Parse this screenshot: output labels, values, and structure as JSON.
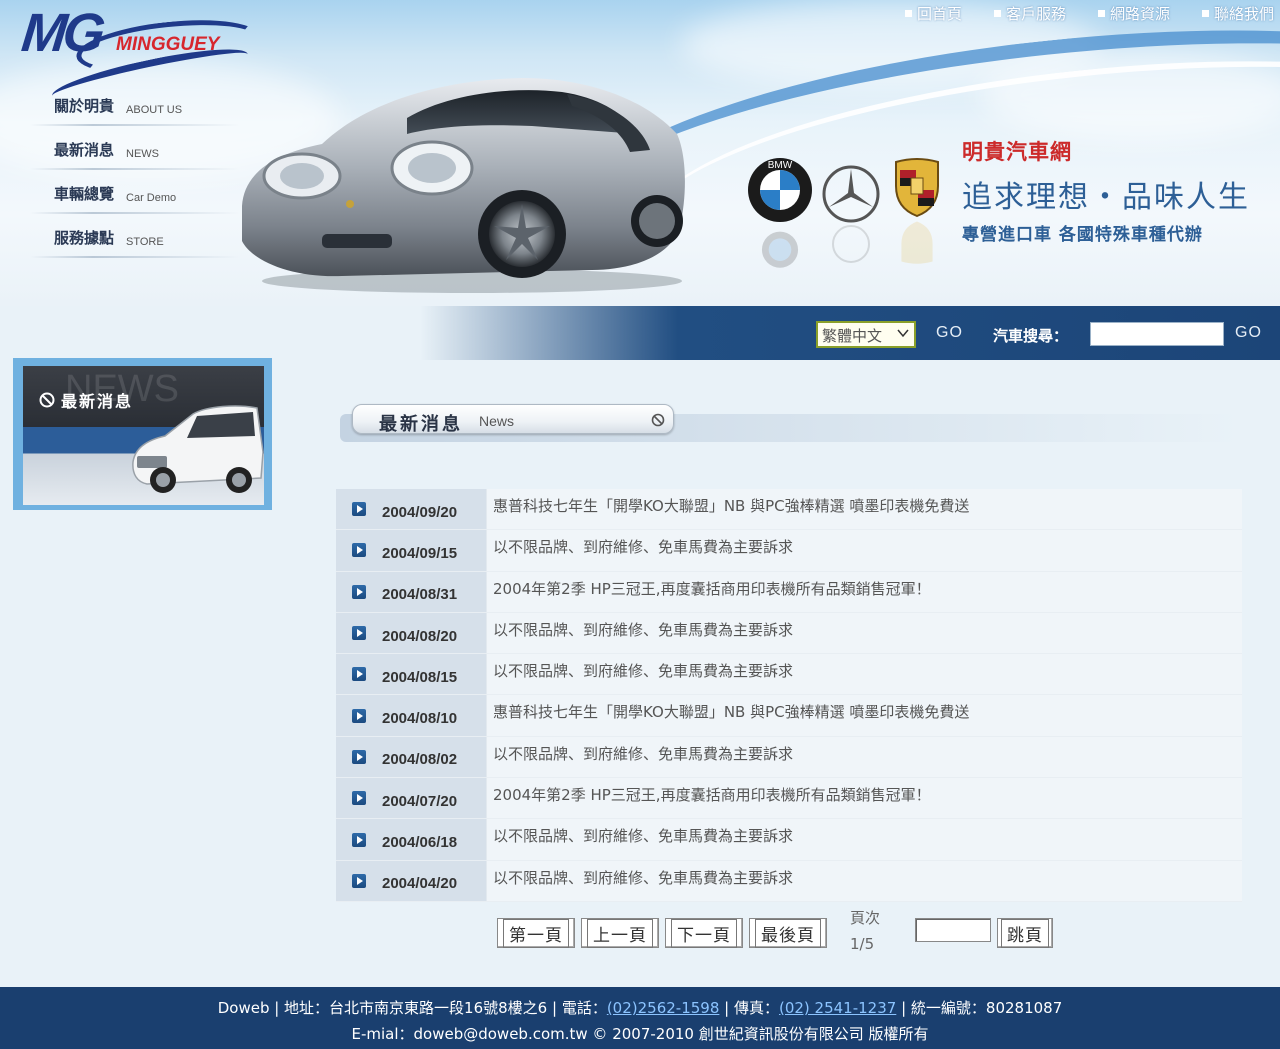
{
  "logo": {
    "mark": "MG",
    "name": "MINGGUEY"
  },
  "topnav": [
    {
      "label": "回首頁"
    },
    {
      "label": "客戶服務"
    },
    {
      "label": "網路資源"
    },
    {
      "label": "聯絡我們"
    }
  ],
  "leftmenu": [
    {
      "zh": "關於明貴",
      "en": "ABOUT US"
    },
    {
      "zh": "最新消息",
      "en": "NEWS"
    },
    {
      "zh": "車輛總覽",
      "en": "Car Demo"
    },
    {
      "zh": "服務據點",
      "en": "STORE"
    }
  ],
  "tagline": {
    "site": "明貴汽車網",
    "slogan": "追求理想・品味人生",
    "sub": "專營進口車 各國特殊車種代辦"
  },
  "brands": {
    "bmw_letters": "BMW"
  },
  "search": {
    "language": "繁體中文",
    "go_label": "GO",
    "label": "汽車搜尋：",
    "value": ""
  },
  "news_banner": {
    "ghost": "NEWS",
    "title": "最新消息"
  },
  "section": {
    "zh": "最新消息",
    "en": "News"
  },
  "news": [
    {
      "date": "2004/09/20",
      "headline": "惠普科技七年生「開學KO大聯盟」NB 與PC強棒精選 噴墨印表機免費送"
    },
    {
      "date": "2004/09/15",
      "headline": "以不限品牌、到府維修、免車馬費為主要訴求"
    },
    {
      "date": "2004/08/31",
      "headline": "2004年第2季 HP三冠王,再度囊括商用印表機所有品類銷售冠軍！"
    },
    {
      "date": "2004/08/20",
      "headline": "以不限品牌、到府維修、免車馬費為主要訴求"
    },
    {
      "date": "2004/08/15",
      "headline": "以不限品牌、到府維修、免車馬費為主要訴求"
    },
    {
      "date": "2004/08/10",
      "headline": "惠普科技七年生「開學KO大聯盟」NB 與PC強棒精選 噴墨印表機免費送"
    },
    {
      "date": "2004/08/02",
      "headline": "以不限品牌、到府維修、免車馬費為主要訴求"
    },
    {
      "date": "2004/07/20",
      "headline": "2004年第2季 HP三冠王,再度囊括商用印表機所有品類銷售冠軍！"
    },
    {
      "date": "2004/06/18",
      "headline": "以不限品牌、到府維修、免車馬費為主要訴求"
    },
    {
      "date": "2004/04/20",
      "headline": "以不限品牌、到府維修、免車馬費為主要訴求"
    }
  ],
  "pager": {
    "first": "第一頁",
    "prev": "上一頁",
    "next": "下一頁",
    "last": "最後頁",
    "page_label": "頁次",
    "page_info": "1/5",
    "jump": "跳頁",
    "jump_value": ""
  },
  "footer": {
    "line1_a": "Doweb | 地址：台北市南京東路一段16號8樓之6 | 電話：",
    "phone": "(02)2562-1598",
    "line1_b": " | 傳真：",
    "fax": "(02) 2541-1237",
    "line1_c": " | 統一編號：80281087",
    "line2": "E-mial：doweb@doweb.com.tw © 2007-2010 創世紀資訊股份有限公司 版權所有"
  },
  "colors": {
    "nav_bar": "#1c4578",
    "footer": "#1a3f6f",
    "brand_red": "#cc2a2a",
    "brand_blue": "#2d5f96"
  }
}
